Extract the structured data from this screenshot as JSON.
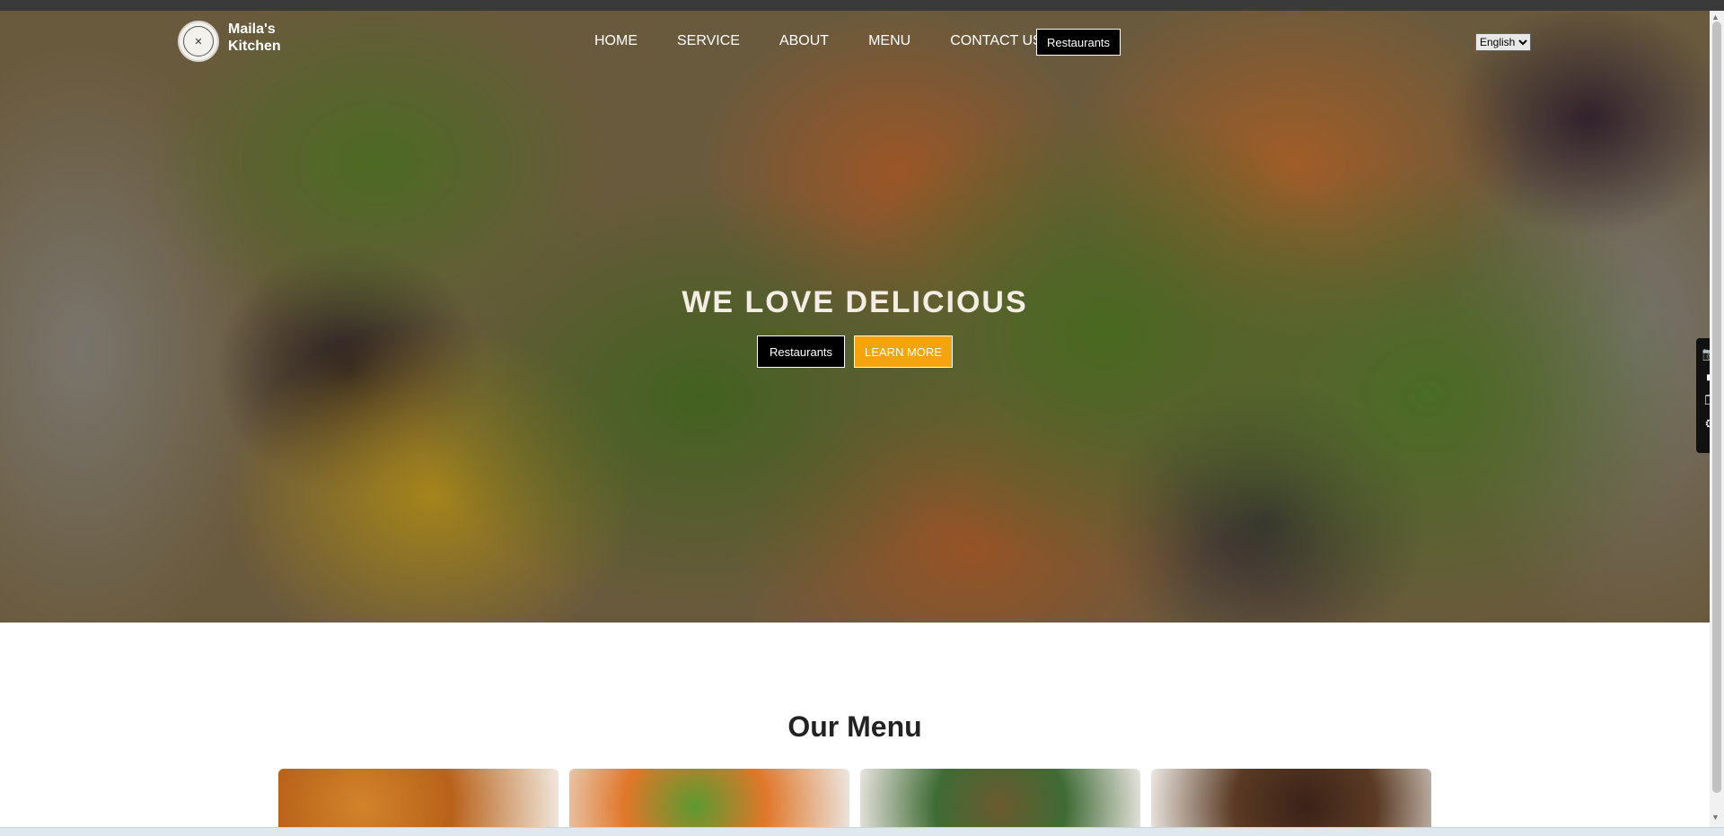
{
  "brand": {
    "name": "Maila's Kitchen"
  },
  "nav": {
    "items": [
      "HOME",
      "SERVICE",
      "ABOUT",
      "MENU",
      "CONTACT US"
    ],
    "restaurants_button": "Restaurants"
  },
  "language": {
    "selected": "English"
  },
  "hero": {
    "title": "WE LOVE DELICIOUS",
    "primary_button": "Restaurants",
    "secondary_button": "LEARN MORE"
  },
  "menu": {
    "title": "Our Menu"
  },
  "icons": [
    "camera-icon",
    "video-icon",
    "window-icon",
    "gear-icon"
  ],
  "colors": {
    "accent": "#f5a40b",
    "dark": "#000000"
  }
}
